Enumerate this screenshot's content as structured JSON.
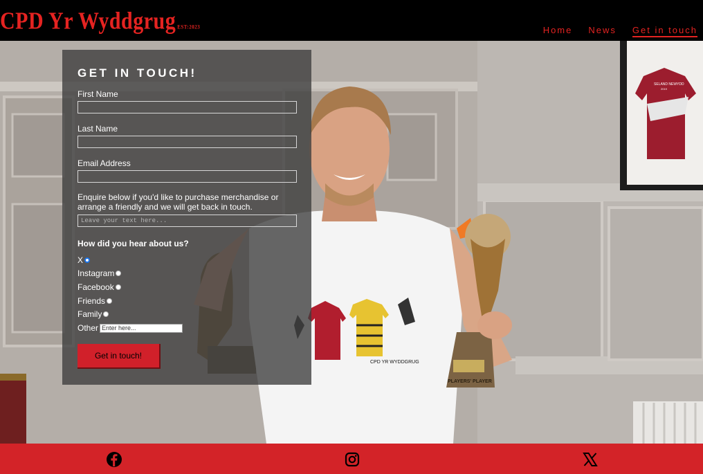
{
  "header": {
    "logo_text": "CPD Yr Wyddgrug",
    "logo_est": "EST:2023",
    "nav": [
      {
        "label": "Home",
        "active": false
      },
      {
        "label": "News",
        "active": false
      },
      {
        "label": "Get in touch",
        "active": true
      }
    ]
  },
  "form": {
    "title": "GET IN TOUCH!",
    "first_name_label": "First Name",
    "last_name_label": "Last Name",
    "email_label": "Email Address",
    "enquiry_label": "Enquire below if you'd like to purchase merchandise or arrange a friendly and we will get back in touch.",
    "enquiry_placeholder": "Leave your text here...",
    "question": "How did you hear about us?",
    "options": [
      {
        "label": "X",
        "checked": true
      },
      {
        "label": "Instagram",
        "checked": false
      },
      {
        "label": "Facebook",
        "checked": false
      },
      {
        "label": "Friends",
        "checked": false
      },
      {
        "label": "Family",
        "checked": false
      }
    ],
    "other_label": "Other",
    "other_placeholder": "Enter here...",
    "submit_label": "Get in touch!"
  },
  "hero": {
    "shirt_text": "CPD YR WYDDGRUG",
    "trophy_text": "PLAYERS' PLAYER",
    "frame_text": "SELAND NEWYDD",
    "frame_year": "2019"
  },
  "footer": {
    "icons": [
      "facebook-icon",
      "instagram-icon",
      "x-icon"
    ]
  },
  "colors": {
    "brand_red": "#e52321",
    "footer_red": "#d32328",
    "header_bg": "#000000",
    "panel_bg": "rgba(60,60,60,0.78)",
    "radio_accent": "#1a73e8"
  }
}
